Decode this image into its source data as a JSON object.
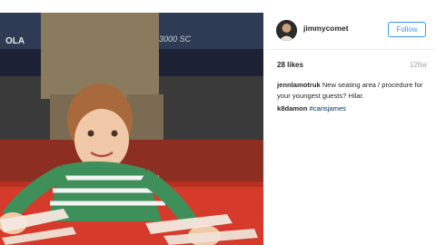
{
  "post": {
    "photo_label": "Photo of a toddler in a striped shirt with arms taped to a red table",
    "background_signs": [
      "OLA",
      "3000 SC"
    ]
  },
  "header": {
    "username": "jimmycomet",
    "follow_label": "Follow"
  },
  "meta": {
    "likes": "28 likes",
    "time": "126w"
  },
  "caption": {
    "author": "jennlamotruk",
    "text": "New seating area / procedure for your youngest guests? Hilar."
  },
  "comments": [
    {
      "author": "k8damon",
      "tag": "#carisjames"
    }
  ],
  "colors": {
    "accent": "#3897f0",
    "tag": "#003569",
    "table": "#d63a2b"
  }
}
